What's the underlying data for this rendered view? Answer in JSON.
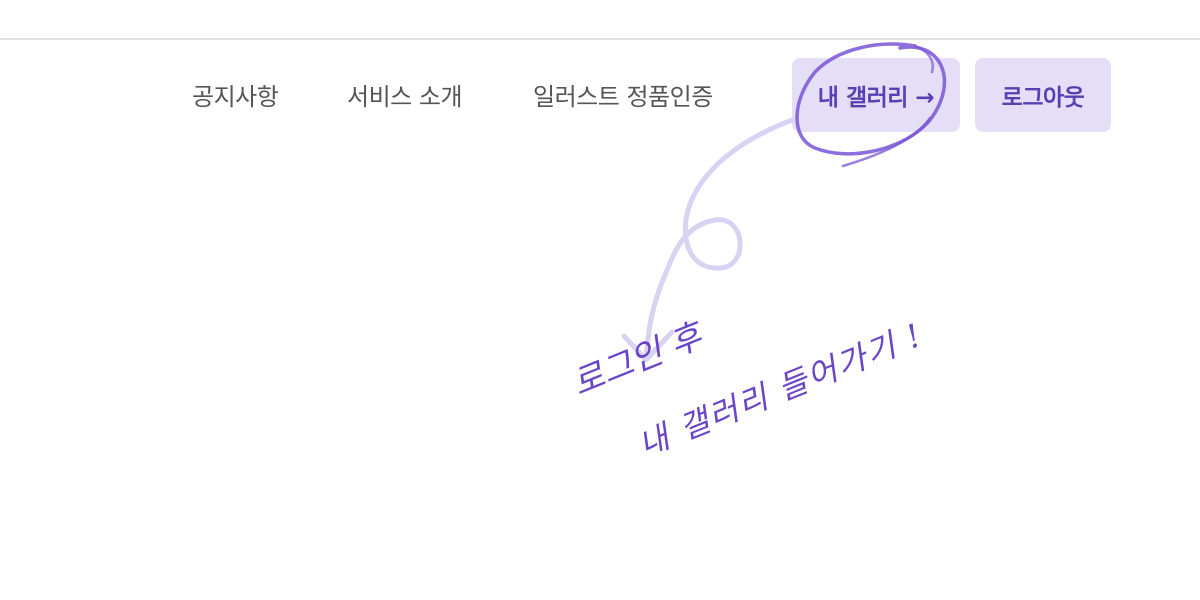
{
  "nav": {
    "links": [
      {
        "label": "공지사항"
      },
      {
        "label": "서비스 소개"
      },
      {
        "label": "일러스트 정품인증"
      }
    ],
    "gallery_button": "내 갤러리 →",
    "logout_button": "로그아웃"
  },
  "annotation": {
    "line1": "로그인 후",
    "line2": "내 갤러리 들어가기 !"
  },
  "colors": {
    "accent": "#6a45c8",
    "button_bg": "#e4def7",
    "arrow_light": "#d9d2f2",
    "nav_text": "#555555"
  }
}
